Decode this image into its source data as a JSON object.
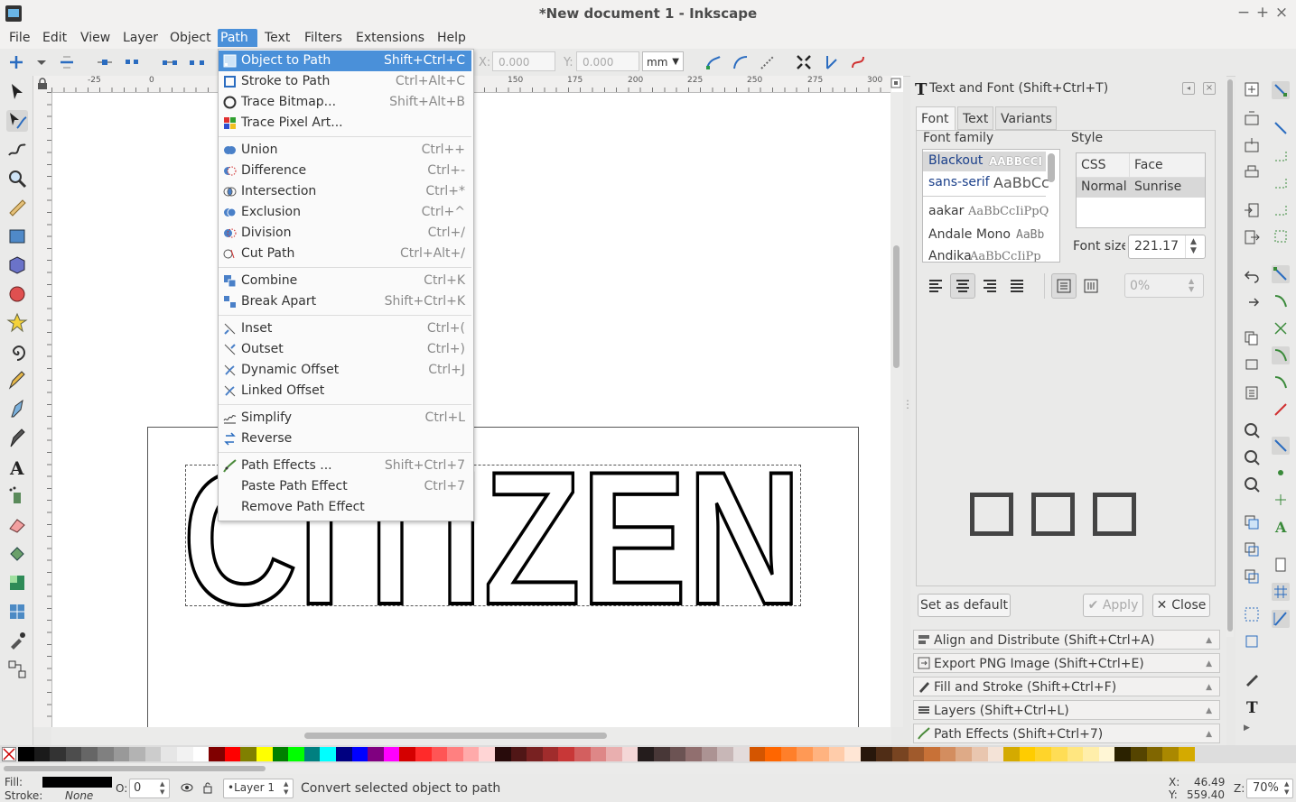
{
  "window": {
    "title": "*New document 1 - Inkscape"
  },
  "menubar": {
    "items": [
      "File",
      "Edit",
      "View",
      "Layer",
      "Object",
      "Path",
      "Text",
      "Filters",
      "Extensions",
      "Help"
    ]
  },
  "toolbar": {
    "x_label": "X:",
    "x_value": "0.000",
    "y_label": "Y:",
    "y_value": "0.000",
    "unit": "mm"
  },
  "path_menu": {
    "items": [
      {
        "label": "Object to Path",
        "shortcut": "Shift+Ctrl+C"
      },
      {
        "label": "Stroke to Path",
        "shortcut": "Ctrl+Alt+C"
      },
      {
        "label": "Trace Bitmap...",
        "shortcut": "Shift+Alt+B"
      },
      {
        "label": "Trace Pixel Art...",
        "shortcut": ""
      },
      {
        "label": "Union",
        "shortcut": "Ctrl++"
      },
      {
        "label": "Difference",
        "shortcut": "Ctrl+-"
      },
      {
        "label": "Intersection",
        "shortcut": "Ctrl+*"
      },
      {
        "label": "Exclusion",
        "shortcut": "Ctrl+^"
      },
      {
        "label": "Division",
        "shortcut": "Ctrl+/"
      },
      {
        "label": "Cut Path",
        "shortcut": "Ctrl+Alt+/"
      },
      {
        "label": "Combine",
        "shortcut": "Ctrl+K"
      },
      {
        "label": "Break Apart",
        "shortcut": "Shift+Ctrl+K"
      },
      {
        "label": "Inset",
        "shortcut": "Ctrl+("
      },
      {
        "label": "Outset",
        "shortcut": "Ctrl+)"
      },
      {
        "label": "Dynamic Offset",
        "shortcut": "Ctrl+J"
      },
      {
        "label": "Linked Offset",
        "shortcut": ""
      },
      {
        "label": "Simplify",
        "shortcut": "Ctrl+L"
      },
      {
        "label": "Reverse",
        "shortcut": ""
      },
      {
        "label": "Path Effects ...",
        "shortcut": "Shift+Ctrl+7"
      },
      {
        "label": "Paste Path Effect",
        "shortcut": "Ctrl+7"
      },
      {
        "label": "Remove Path Effect",
        "shortcut": ""
      }
    ]
  },
  "ruler": {
    "h_labels": [
      "-25",
      "0",
      "150",
      "175",
      "200",
      "225",
      "250",
      "275",
      "300"
    ]
  },
  "canvas": {
    "text": "CITIZEN"
  },
  "text_font_panel": {
    "title": "Text and Font (Shift+Ctrl+T)",
    "tabs": [
      "Font",
      "Text",
      "Variants"
    ],
    "font_family_label": "Font family",
    "style_label": "Style",
    "fonts": [
      {
        "name": "Blackout",
        "sample": "AABBCCI"
      },
      {
        "name": "sans-serif",
        "sample": "AaBbCc"
      },
      {
        "name": "aakar",
        "sample": "AaBbCcIiPpQ"
      },
      {
        "name": "Andale Mono",
        "sample": "AaBb"
      },
      {
        "name": "Andika",
        "sample": "AaBbCcIiPp"
      }
    ],
    "style_headers": [
      "CSS",
      "Face"
    ],
    "style_row": {
      "css": "Normal",
      "face": "Sunrise"
    },
    "font_size_label": "Font size",
    "font_size_value": "221.17",
    "spacing_value": "0%",
    "set_default_label": "Set as default",
    "apply_label": "Apply",
    "close_label": "Close"
  },
  "dock_panels": [
    "Align and Distribute (Shift+Ctrl+A)",
    "Export PNG Image (Shift+Ctrl+E)",
    "Fill and Stroke (Shift+Ctrl+F)",
    "Layers (Shift+Ctrl+L)",
    "Path Effects  (Shift+Ctrl+7)"
  ],
  "status": {
    "fill_label": "Fill:",
    "stroke_label": "Stroke:",
    "stroke_value": "None",
    "opacity_label": "O:",
    "opacity_value": "0",
    "layer": "•Layer 1",
    "message": "Convert selected object to path",
    "x_label": "X:",
    "x_value": "46.49",
    "y_label": "Y:",
    "y_value": "559.40",
    "zoom_label": "Z:",
    "zoom_value": "70%"
  },
  "palette": [
    "#000000",
    "#1a1a1a",
    "#333333",
    "#4d4d4d",
    "#666666",
    "#808080",
    "#999999",
    "#b3b3b3",
    "#cccccc",
    "#e6e6e6",
    "#f2f2f2",
    "#ffffff",
    "#800000",
    "#ff0000",
    "#808000",
    "#ffff00",
    "#008000",
    "#00ff00",
    "#008080",
    "#00ffff",
    "#000080",
    "#0000ff",
    "#800080",
    "#ff00ff",
    "#d40000",
    "#ff2a2a",
    "#ff5555",
    "#ff8080",
    "#ffaaaa",
    "#ffd5d5",
    "#280b0b",
    "#501616",
    "#782121",
    "#a02c2c",
    "#c83737",
    "#d35f5f",
    "#de8787",
    "#e9afaf",
    "#f4d7d7",
    "#241c1c",
    "#483737",
    "#6c5353",
    "#916f6f",
    "#ac9393",
    "#c8b7b7",
    "#e3dbdb",
    "#d45500",
    "#ff6600",
    "#ff7f2a",
    "#ff9955",
    "#ffb380",
    "#ffccaa",
    "#ffe6d5",
    "#28170b",
    "#502d16",
    "#784421",
    "#a05a2c",
    "#c87137",
    "#d38d5f",
    "#deaa87",
    "#e9c6af",
    "#f4e3d7",
    "#d4aa00",
    "#ffcc00",
    "#ffd42a",
    "#ffdd55",
    "#ffe680",
    "#ffeeaa",
    "#fff6d5",
    "#2b2200",
    "#554400",
    "#806600",
    "#aa8800",
    "#d4aa00"
  ]
}
